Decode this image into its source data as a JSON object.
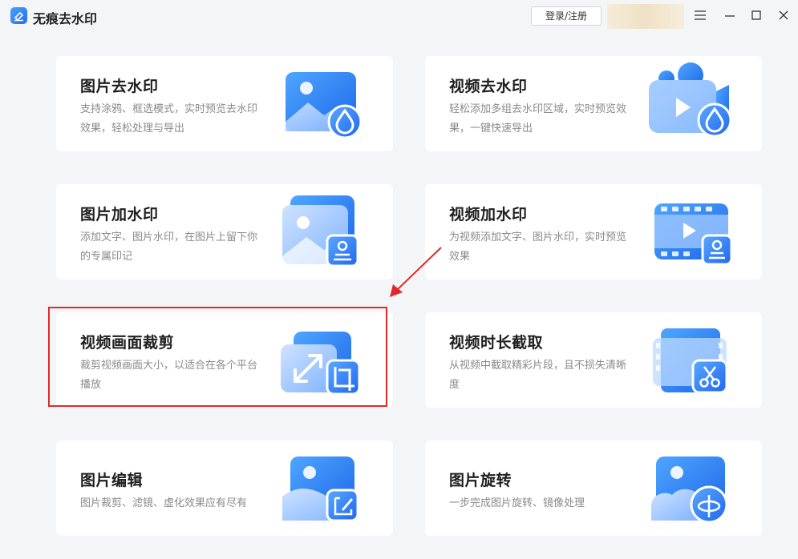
{
  "app": {
    "title": "无痕去水印",
    "login_label": "登录/注册"
  },
  "icons": {
    "logo": "eraser-logo-icon",
    "menu": "hamburger-menu-icon",
    "minimize": "minimize-icon",
    "maximize": "maximize-icon",
    "close": "close-icon"
  },
  "colors": {
    "accent": "#2d7ff9",
    "highlight": "#e02a2a",
    "background": "#f4f5f7"
  },
  "cards": [
    {
      "title": "图片去水印",
      "desc": "支持涂鸦、框选模式，实时预览去水印效果，轻松处理与导出",
      "icon": "image-droplet-icon"
    },
    {
      "title": "视频去水印",
      "desc": "轻松添加多组去水印区域，实时预览效果，一键快速导出",
      "icon": "video-droplet-icon"
    },
    {
      "title": "图片加水印",
      "desc": "添加文字、图片水印，在图片上留下你的专属印记",
      "icon": "image-stamp-icon"
    },
    {
      "title": "视频加水印",
      "desc": "为视频添加文字、图片水印，实时预览效果",
      "icon": "video-stamp-icon"
    },
    {
      "title": "视频画面裁剪",
      "desc": "裁剪视频画面大小，以适合在各个平台播放",
      "icon": "resize-crop-icon"
    },
    {
      "title": "视频时长截取",
      "desc": "从视频中截取精彩片段，且不损失清晰度",
      "icon": "film-scissors-icon"
    },
    {
      "title": "图片编辑",
      "desc": "图片裁剪、滤镜、虚化效果应有尽有",
      "icon": "image-edit-icon"
    },
    {
      "title": "图片旋转",
      "desc": "一步完成图片旋转、镜像处理",
      "icon": "image-rotate-icon"
    }
  ]
}
